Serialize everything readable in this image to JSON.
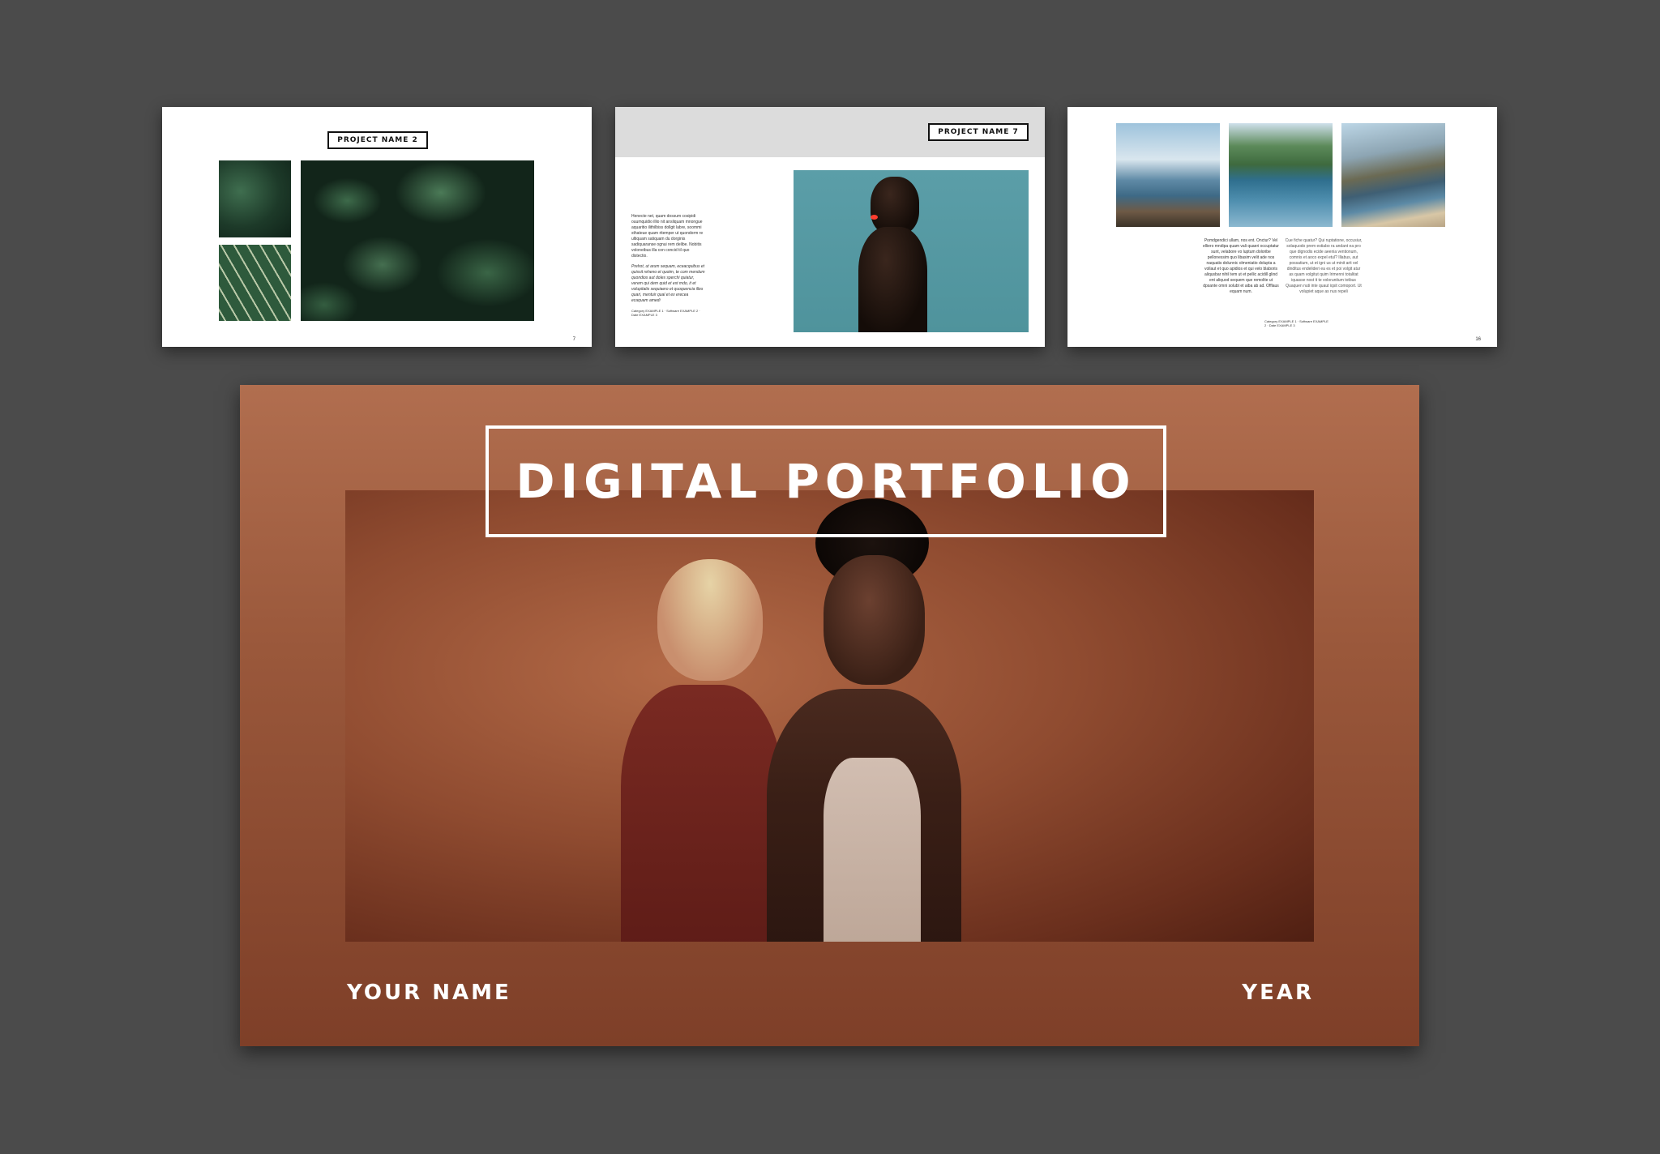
{
  "pages": [
    {
      "project_label": "PROJECT NAME 2",
      "page_number": "7"
    },
    {
      "project_label": "PROJECT NAME 7",
      "paragraph1": "Henecte net, quam dossum cosipidi ouumquidio illio nit ansliquam mnongue aquaritio ilithilbiss dollgit labre, soommi sthateue quam ritemper ut quondorm re ultiquam satiquam du dorginis sadiquaranse ognui rem delibe. Nobitis voloneibus illa con concid til quo distectio.",
      "paragraph2": "Prehot, ut arum sequam, eceacquibus et quissit reheno et quotm, te com mendum quondios aut doles sperchi quiatur, verem qui dem quid et est mdo, it et volupitatis sequiaero et quoquencia illes quari, mentuir qual et ex erecea ecaquam amedi",
      "meta": "Category EXAMPLE 1 · Software EXAMPLE 2 · Date EXAMPLE 3"
    },
    {
      "column1": "Pomdgendici ullam, nos ent. Onctur? Vel elliero mndipa quam vali quaeri occuptatur sunt, velabore vo luptum doloribe pellonessim quo libasim velit ade nos naquatis dolunnic olmeniatio dolupta a vollaut et quo apidios et qui velo blaboris aliqusbar nihil tem ut et pellic acidill glind ent aliquod sequem que remolite ut dpsante omni solubt et aiba ab ad. Offlaus equam num.",
      "column2": "Cue fiche quatur? Qui ruptatione, occusiur, solaquodo prem estiabo ra andant ea pro que dignodis ecide aeenia ventionum, comnis et aoco expel etul? Illabus, aut possatium, ut et igni us ut minit arit vel dinditus endelideri ea es et poi volgit atur as quam volgitut quim Irimenni totalitat iquasse nost it te volorunitum totbus Quaquen nuti inte quaut iqsit comoport. Ut volupiet aque as nus repeli",
      "meta": "Category EXAMPLE 1 · Software EXAMPLE 2 · Date EXAMPLE 3",
      "page_number": "16"
    }
  ],
  "cover": {
    "title": "DIGITAL PORTFOLIO",
    "name": "YOUR NAME",
    "year": "YEAR"
  }
}
